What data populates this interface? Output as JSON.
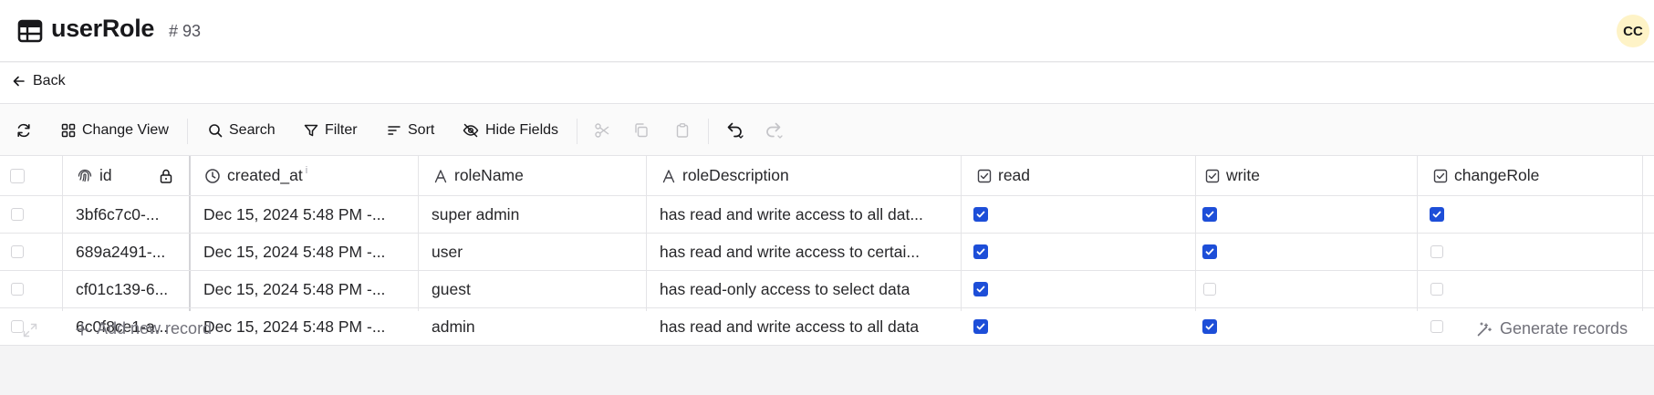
{
  "header": {
    "title": "userRole",
    "count": "# 93",
    "avatar": "CC"
  },
  "nav": {
    "back_label": "Back"
  },
  "toolbar": {
    "change_view": "Change View",
    "search": "Search",
    "filter": "Filter",
    "sort": "Sort",
    "hide_fields": "Hide Fields"
  },
  "columns": {
    "id": "id",
    "created_at": "created_at",
    "created_at_info": "i",
    "roleName": "roleName",
    "roleDescription": "roleDescription",
    "read": "read",
    "write": "write",
    "changeRole": "changeRole"
  },
  "rows": [
    {
      "id": "3bf6c7c0-...",
      "created_at": "Dec 15, 2024 5:48 PM -...",
      "roleName": "super admin",
      "roleDescription": "has read and write access to all dat...",
      "read": true,
      "write": true,
      "changeRole": true
    },
    {
      "id": "689a2491-...",
      "created_at": "Dec 15, 2024 5:48 PM -...",
      "roleName": "user",
      "roleDescription": "has read and write access to certai...",
      "read": true,
      "write": true,
      "changeRole": false
    },
    {
      "id": "cf01c139-6...",
      "created_at": "Dec 15, 2024 5:48 PM -...",
      "roleName": "guest",
      "roleDescription": "has read-only access to select data",
      "read": true,
      "write": false,
      "changeRole": false
    },
    {
      "id": "6c0f8ce1-a...",
      "created_at": "Dec 15, 2024 5:48 PM -...",
      "roleName": "admin",
      "roleDescription": "has read and write access to all data",
      "read": true,
      "write": true,
      "changeRole": false
    }
  ],
  "footer": {
    "add_label": "Add new record",
    "generate_label": "Generate records"
  },
  "colors": {
    "accent": "#1d4ed8",
    "border": "#e4e4e7",
    "avatar_bg": "#fef3c7"
  }
}
